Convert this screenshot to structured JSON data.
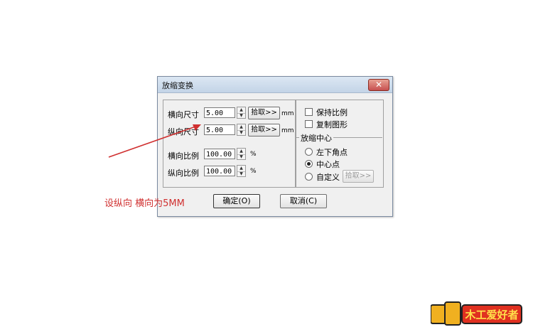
{
  "dialog": {
    "title": "放缩变换",
    "close_label": "✕",
    "size": {
      "h_label": "横向尺寸",
      "h_value": "5.00",
      "h_unit": "mm",
      "v_label": "纵向尺寸",
      "v_value": "5.00",
      "v_unit": "mm",
      "pick_label": "拾取>>"
    },
    "ratio": {
      "h_label": "横向比例",
      "h_value": "100.00",
      "h_unit": "%",
      "v_label": "纵向比例",
      "v_value": "100.00",
      "v_unit": "%"
    },
    "options": {
      "keep_ratio": "保持比例",
      "copy_shape": "复制图形"
    },
    "center": {
      "legend": "放缩中心",
      "bottom_left": "左下角点",
      "center_point": "中心点",
      "custom": "自定义",
      "custom_pick": "拾取>>",
      "selected": "中心点"
    },
    "ok_label": "确定(O)",
    "cancel_label": "取消(C)"
  },
  "annotation": {
    "text": "设纵向 横向为5MM",
    "color": "#d03030"
  },
  "logo": {
    "text": "木工爱好者"
  }
}
